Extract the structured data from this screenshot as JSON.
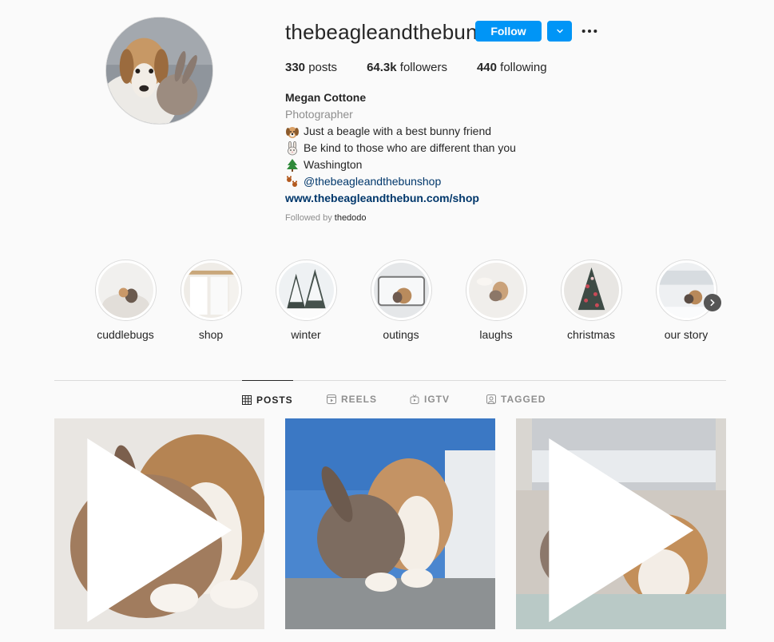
{
  "profile": {
    "username": "thebeagleandthebun",
    "follow_label": "Follow",
    "stats": {
      "posts_value": "330",
      "posts_label": " posts",
      "followers_value": "64.3k",
      "followers_label": " followers",
      "following_value": "440",
      "following_label": " following"
    },
    "bio": {
      "name": "Megan Cottone",
      "category": "Photographer",
      "line1": "Just a beagle with a best bunny friend",
      "line2": "Be kind to those who are different than you",
      "line3": "Washington",
      "mention": "@thebeagleandthebunshop",
      "website": "www.thebeagleandthebun.com/shop"
    },
    "followed_by_prefix": "Followed by ",
    "followed_by_user": "thedodo"
  },
  "highlights": [
    {
      "label": "cuddlebugs"
    },
    {
      "label": "shop"
    },
    {
      "label": "winter"
    },
    {
      "label": "outings"
    },
    {
      "label": "laughs"
    },
    {
      "label": "christmas"
    },
    {
      "label": "our story"
    }
  ],
  "tabs": [
    {
      "label": "POSTS",
      "active": true
    },
    {
      "label": "REELS"
    },
    {
      "label": "IGTV"
    },
    {
      "label": "TAGGED"
    }
  ],
  "colors": {
    "accent": "#0095f6",
    "link": "#00376b",
    "muted": "#8e8e8e",
    "background": "#fafafa"
  }
}
